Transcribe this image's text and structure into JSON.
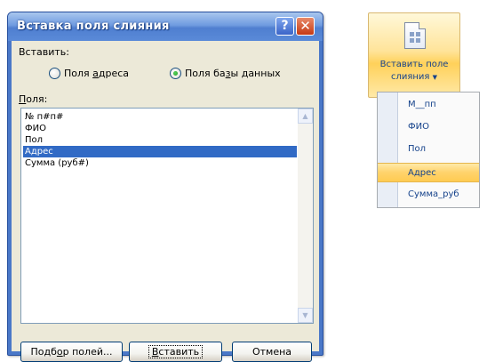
{
  "dialog": {
    "title": "Вставка поля слияния",
    "help_glyph": "?",
    "close_glyph": "✕",
    "insert_label": "Вставить:",
    "radio_options": [
      {
        "label_pre": "Поля ",
        "label_u": "а",
        "label_post": "дреса",
        "checked": false
      },
      {
        "label_pre": "Поля ба",
        "label_u": "з",
        "label_post": "ы данных",
        "checked": true
      }
    ],
    "fields_label_u": "П",
    "fields_label_rest": "оля:",
    "fields": [
      "№ п#п#",
      "ФИО",
      "Пол",
      "Адрес",
      "Сумма (руб#)"
    ],
    "selected_index": 3,
    "buttons": {
      "match_pre": "Подб",
      "match_u": "о",
      "match_post": "р полей...",
      "insert_u": "В",
      "insert_rest": "ставить",
      "cancel": "Отмена"
    }
  },
  "ribbon": {
    "button_line1": "Вставить поле",
    "button_line2": "слияния",
    "dropdown_arrow": "▼",
    "menu_items": [
      "М__пп",
      "ФИО",
      "Пол",
      "Адрес",
      "Сумма_руб"
    ],
    "highlighted_index": 3
  },
  "colors": {
    "selection": "#316ac5",
    "ribbon_highlight": "#ffd36b",
    "title_bar": "#4f7fd0"
  }
}
